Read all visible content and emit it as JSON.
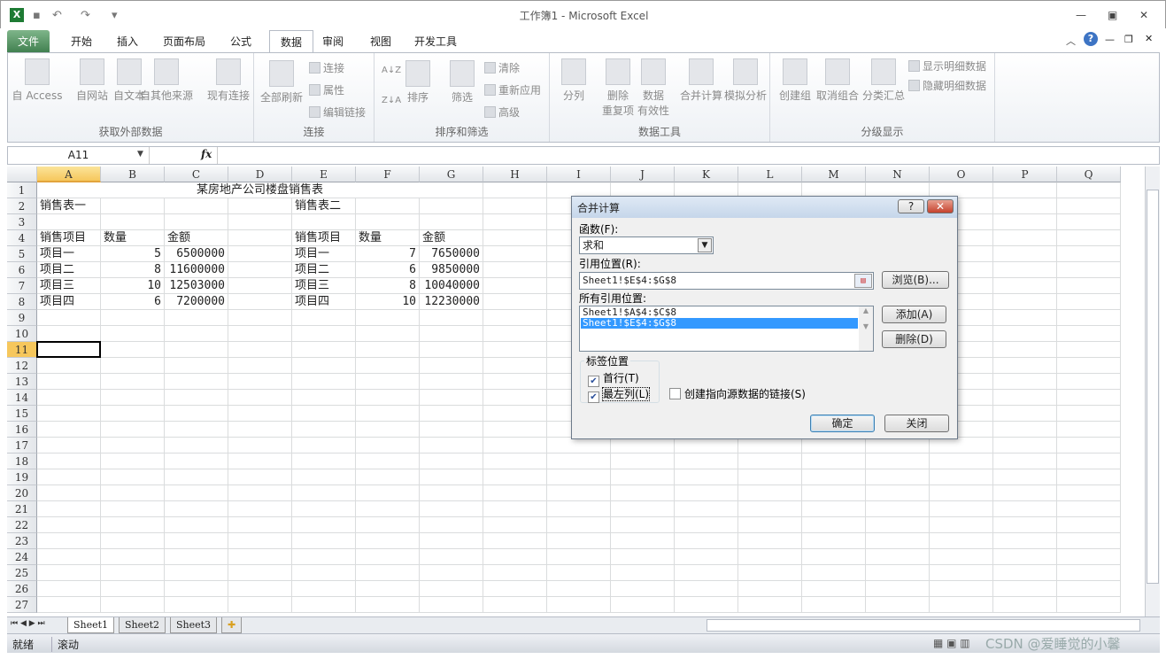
{
  "window": {
    "title": "工作簿1 - Microsoft Excel",
    "minimize": "▭",
    "restore": "▣",
    "close": "✕"
  },
  "qat": {
    "save": "▪",
    "undo": "↶",
    "redo": "↷",
    "customize": "▾"
  },
  "ribbon_tabs": [
    "文件",
    "开始",
    "插入",
    "页面布局",
    "公式",
    "数据",
    "审阅",
    "视图",
    "开发工具"
  ],
  "active_tab": "数据",
  "ribbon": {
    "get_external": {
      "label": "获取外部数据",
      "buttons": [
        "自 Access",
        "自网站",
        "自文本",
        "自其他来源",
        "现有连接"
      ]
    },
    "connections": {
      "label": "连接",
      "refresh": "全部刷新",
      "small": [
        "连接",
        "属性",
        "编辑链接"
      ]
    },
    "sort_filter": {
      "label": "排序和筛选",
      "sort": "排序",
      "filter": "筛选",
      "small": [
        "清除",
        "重新应用",
        "高级"
      ]
    },
    "data_tools": {
      "label": "数据工具",
      "buttons": [
        "分列",
        "删除\n重复项",
        "数据\n有效性",
        "合并计算",
        "模拟分析"
      ]
    },
    "outline": {
      "label": "分级显示",
      "buttons": [
        "创建组",
        "取消组合",
        "分类汇总"
      ],
      "small": [
        "显示明细数据",
        "隐藏明细数据"
      ]
    }
  },
  "formula_bar": {
    "name_box": "A11",
    "fx": "fx",
    "value": ""
  },
  "columns": [
    "A",
    "B",
    "C",
    "D",
    "E",
    "F",
    "G",
    "H",
    "I",
    "J",
    "K",
    "L",
    "M",
    "N",
    "O",
    "P",
    "Q"
  ],
  "selected_cell": "A11",
  "title_cell": "某房地产公司楼盘销售表",
  "cells": [
    [
      "",
      "",
      "",
      "",
      "",
      "",
      ""
    ],
    [
      "销售表一",
      "",
      "",
      "",
      "销售表二",
      "",
      ""
    ],
    [
      "",
      "",
      "",
      "",
      "",
      "",
      ""
    ],
    [
      "销售项目",
      "数量",
      "金额",
      "",
      "销售项目",
      "数量",
      "金额"
    ],
    [
      "项目一",
      "5",
      "6500000",
      "",
      "项目一",
      "7",
      "7650000"
    ],
    [
      "项目二",
      "8",
      "11600000",
      "",
      "项目二",
      "6",
      "9850000"
    ],
    [
      "项目三",
      "10",
      "12503000",
      "",
      "项目三",
      "8",
      "10040000"
    ],
    [
      "项目四",
      "6",
      "7200000",
      "",
      "项目四",
      "10",
      "12230000"
    ]
  ],
  "row_count": 27,
  "sheets": [
    "Sheet1",
    "Sheet2",
    "Sheet3"
  ],
  "active_sheet": "Sheet1",
  "status": {
    "ready": "就绪",
    "scroll": "滚动",
    "watermark": "CSDN @爱睡觉的小馨"
  },
  "dialog": {
    "title": "合并计算",
    "help": "?",
    "close": "✕",
    "function_label": "函数(F):",
    "function_value": "求和",
    "reference_label": "引用位置(R):",
    "reference_value": "Sheet1!$E$4:$G$8",
    "browse": "浏览(B)...",
    "all_refs_label": "所有引用位置:",
    "all_refs": [
      "Sheet1!$A$4:$C$8",
      "Sheet1!$E$4:$G$8"
    ],
    "selected_ref": 1,
    "add": "添加(A)",
    "delete": "删除(D)",
    "labels_group": "标签位置",
    "top_row": {
      "label": "首行(T)",
      "checked": true
    },
    "left_column": {
      "label": "最左列(L)",
      "checked": true
    },
    "create_links": {
      "label": "创建指向源数据的链接(S)",
      "checked": false
    },
    "ok": "确定",
    "cancel": "关闭"
  }
}
